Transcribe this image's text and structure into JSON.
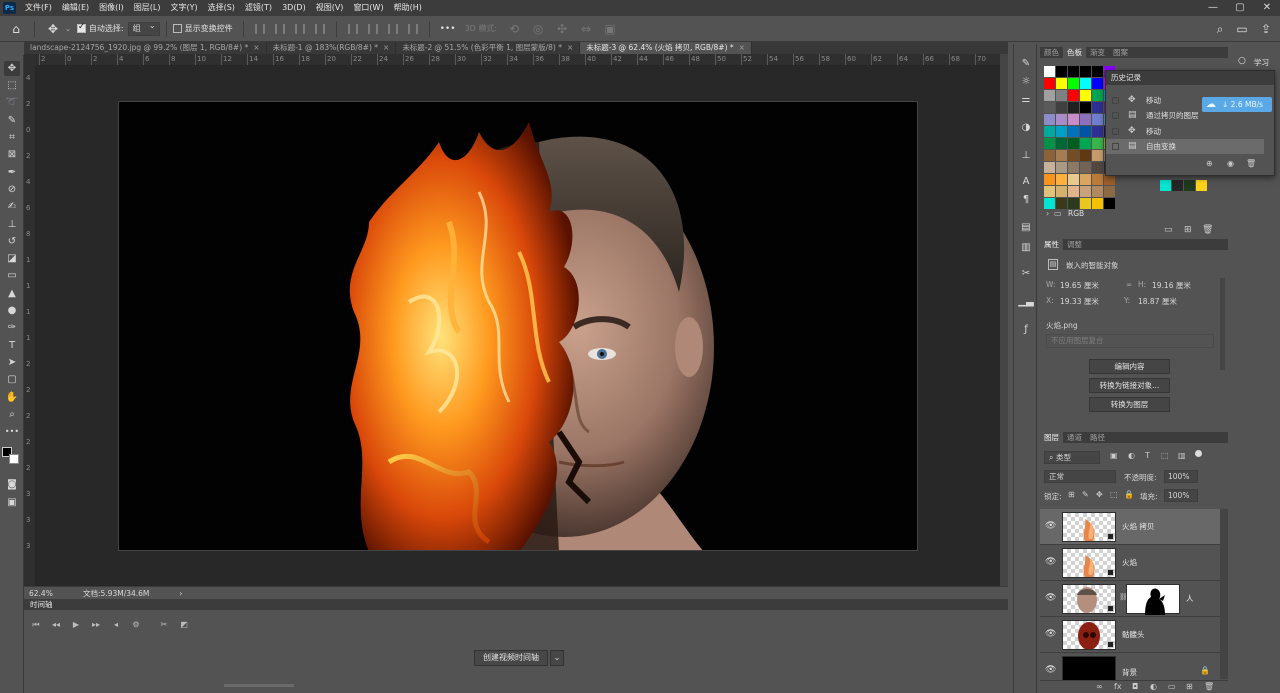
{
  "menubar": {
    "items": [
      "文件(F)",
      "编辑(E)",
      "图像(I)",
      "图层(L)",
      "文字(Y)",
      "选择(S)",
      "滤镜(T)",
      "3D(D)",
      "视图(V)",
      "窗口(W)",
      "帮助(H)"
    ],
    "logo": "Ps"
  },
  "optionsbar": {
    "auto_select_label": "自动选择:",
    "auto_select_value": "组",
    "show_transform_label": "显示变换控件",
    "mode_3d_label": "3D 模式:",
    "more_label": "•••"
  },
  "tabs": [
    {
      "label": "landscape-2124756_1920.jpg @ 99.2% (图层 1, RGB/8#) *",
      "close": "×"
    },
    {
      "label": "未标题-1 @ 183%(RGB/8#) *",
      "close": "×"
    },
    {
      "label": "未标题-2 @ 51.5% (色彩平衡 1, 图层蒙版/8) *",
      "close": "×"
    },
    {
      "label": "未标题-3 @ 62.4% (火焰 拷贝, RGB/8#) *",
      "close": "×"
    }
  ],
  "ruler": {
    "top_ticks": [
      "2",
      "0",
      "2",
      "4",
      "6",
      "8",
      "10",
      "12",
      "14",
      "16",
      "18",
      "20",
      "22",
      "24",
      "26",
      "28",
      "30",
      "32",
      "34",
      "36",
      "38",
      "40",
      "42",
      "44",
      "46",
      "48",
      "50",
      "52",
      "54",
      "56",
      "58",
      "60",
      "62",
      "64",
      "66",
      "68",
      "70",
      "72"
    ],
    "left_ticks": [
      "4",
      "2",
      "0",
      "2",
      "4",
      "6",
      "8",
      "1",
      "1",
      "1",
      "1",
      "2",
      "2",
      "2",
      "2",
      "2",
      "3",
      "3",
      "3"
    ]
  },
  "status": {
    "zoom": "62.4%",
    "doc": "文档:5.93M/34.6M",
    "arrow": "›"
  },
  "timeline": {
    "title": "时间轴",
    "create_label": "创建视频时间轴"
  },
  "swatches": {
    "tabs": [
      "颜色",
      "色板",
      "渐变",
      "图案"
    ],
    "active_tab": "色板",
    "folder_label": "RGB",
    "colors": [
      "#ffffff",
      "#000000",
      "#000000",
      "#000000",
      "#000000",
      "#8a00ff",
      "#ff0000",
      "#ffff00",
      "#00ff00",
      "#00ffff",
      "#0000ff",
      "#ff00ff",
      "#a0a0a0",
      "#808080",
      "#ff0000",
      "#ffff00",
      "#00a651",
      "#00aeef",
      "#5a5a5a",
      "#404040",
      "#202020",
      "#000000",
      "#2e3192",
      "#662d91",
      "#8c8cc8",
      "#a88cc8",
      "#c88cc8",
      "#8c6fbd",
      "#6f7fd0",
      "#5a9ad8",
      "#00a99d",
      "#00a0c6",
      "#0072bc",
      "#0054a6",
      "#2e3192",
      "#1b1464",
      "#009245",
      "#006837",
      "#005e20",
      "#00a651",
      "#39b54a",
      "#8dc63f",
      "#8c6239",
      "#a67c52",
      "#754c24",
      "#603913",
      "#c69c6d",
      "#998675",
      "#c7b299",
      "#a89a84",
      "#8c7b62",
      "#736357",
      "#534741",
      "#362f2d",
      "#f7941d",
      "#fbb040",
      "#e8c98f",
      "#d9a55f",
      "#b97a3a",
      "#9d5f2b",
      "#e0c27a",
      "#d4b26c",
      "#e2b48c",
      "#c7a27a",
      "#b08a5e",
      "#8c6a44",
      "#00e5d0",
      "#3a3a1a",
      "#2a3a1a",
      "#e8c820",
      "#f2c200",
      "#000000"
    ],
    "extra_colors": [
      "#00e5d0",
      "#262626",
      "#1e3a1e",
      "#ffd21a"
    ]
  },
  "history": {
    "title": "历史记录",
    "items": [
      {
        "label": "移动",
        "icon": "✥"
      },
      {
        "label": "通过拷贝的图层",
        "icon": "▤"
      },
      {
        "label": "移动",
        "icon": "✥"
      },
      {
        "label": "自由变换",
        "icon": "▤"
      }
    ]
  },
  "network_speed": "↓ 2.6 MB/s",
  "properties": {
    "tabs": [
      "属性",
      "调整"
    ],
    "active_tab": "属性",
    "type_label": "嵌入的智能对象",
    "w_label": "W:",
    "w_value": "19.65 厘米",
    "h_label": "H:",
    "h_value": "19.16 厘米",
    "x_label": "X:",
    "x_value": "19.33 厘米",
    "y_label": "Y:",
    "y_value": "18.87 厘米",
    "file_name": "火焰.png",
    "layer_comp_placeholder": "不应用图层复合",
    "btn_edit": "编辑内容",
    "btn_convert_link": "转换为链接对象...",
    "btn_convert_layer": "转换为图层"
  },
  "layers": {
    "tabs": [
      "图层",
      "通道",
      "路径"
    ],
    "active_tab": "图层",
    "filter_label": "类型",
    "blend_mode": "正常",
    "opacity_label": "不透明度:",
    "opacity_value": "100%",
    "lock_label": "锁定:",
    "fill_label": "填充:",
    "fill_value": "100%",
    "items": [
      {
        "name": "火焰 拷贝",
        "selected": true
      },
      {
        "name": "火焰",
        "selected": false
      },
      {
        "name": "人",
        "selected": false
      },
      {
        "name": "骷髅头",
        "selected": false
      },
      {
        "name": "背景",
        "selected": false
      }
    ]
  },
  "top_right": {
    "learn_label": "学习"
  }
}
